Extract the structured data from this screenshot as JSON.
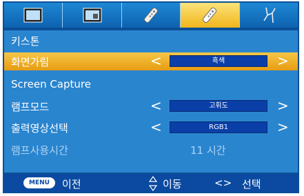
{
  "tabs": [
    {
      "icon": "picture-icon",
      "active": false
    },
    {
      "icon": "screen-icon",
      "active": false
    },
    {
      "icon": "remote-icon",
      "active": false
    },
    {
      "icon": "remote-active-icon",
      "active": true
    },
    {
      "icon": "network-icon",
      "active": false
    }
  ],
  "menu": {
    "header": "키스톤",
    "blank_label": "화면가림",
    "blank_value": "흑색",
    "capture_label": "Screen Capture",
    "lamp_mode_label": "램프모드",
    "lamp_mode_value": "고휘도",
    "output_label": "출력영상선택",
    "output_value": "RGB1",
    "lamp_time_label": "램프사용시간",
    "lamp_time_value": "11  시간",
    "arrow_left": "<",
    "arrow_right": ">"
  },
  "footer": {
    "menu_key": "MENU",
    "back_label": "이전",
    "move_label": "이동",
    "select_key": "<>",
    "select_label": "선택"
  },
  "colors": {
    "panel": "#2a85cf",
    "highlight": "#f0b126",
    "footer": "#0b4aa0",
    "value_box": "#0a3fa8"
  }
}
